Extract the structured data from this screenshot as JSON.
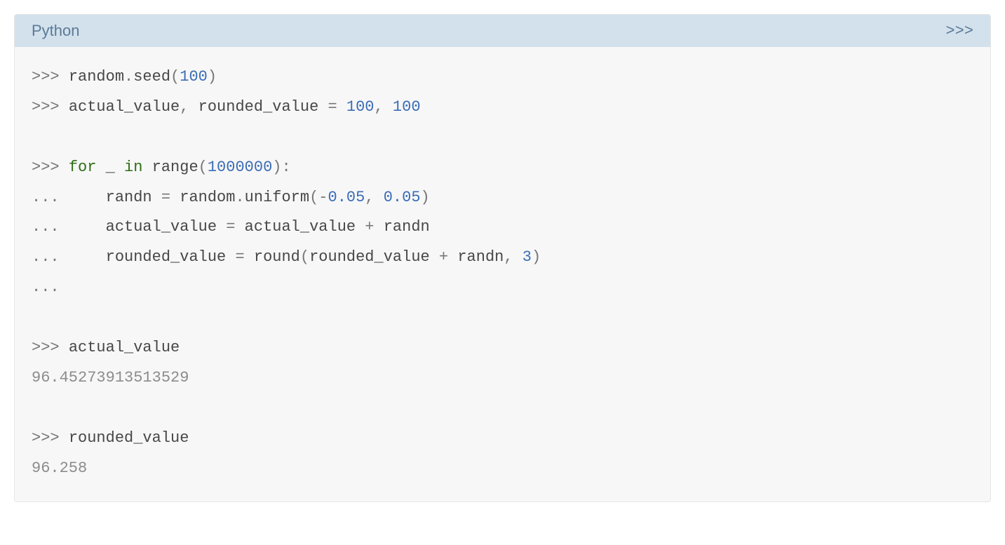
{
  "header": {
    "language": "Python",
    "toggle": ">>>"
  },
  "code": {
    "p1": ">>> ",
    "p2": "... ",
    "l1_ident": "random",
    "l1_dot": ".",
    "l1_func": "seed",
    "l1_lp": "(",
    "l1_n1": "100",
    "l1_rp": ")",
    "l2_a": "actual_value",
    "l2_comma": ", ",
    "l2_b": "rounded_value",
    "l2_eq": " = ",
    "l2_n1": "100",
    "l2_comma2": ", ",
    "l2_n2": "100",
    "l4_for": "for",
    "l4_sp1": " ",
    "l4_us": "_",
    "l4_sp2": " ",
    "l4_in": "in",
    "l4_sp3": " ",
    "l4_range": "range",
    "l4_lp": "(",
    "l4_n": "1000000",
    "l4_rp": "):",
    "l5_indent": "    ",
    "l5_var": "randn",
    "l5_eq": " = ",
    "l5_rand": "random",
    "l5_dot": ".",
    "l5_unif": "uniform",
    "l5_lp": "(",
    "l5_neg": "-",
    "l5_n1": "0.05",
    "l5_comma": ", ",
    "l5_n2": "0.05",
    "l5_rp": ")",
    "l6_var": "actual_value",
    "l6_eq": " = ",
    "l6_var2": "actual_value",
    "l6_plus": " + ",
    "l6_randn": "randn",
    "l7_var": "rounded_value",
    "l7_eq": " = ",
    "l7_round": "round",
    "l7_lp": "(",
    "l7_var2": "rounded_value",
    "l7_plus": " + ",
    "l7_randn": "randn",
    "l7_comma": ", ",
    "l7_n": "3",
    "l7_rp": ")",
    "l10_var": "actual_value",
    "l11_out": "96.45273913513529",
    "l13_var": "rounded_value",
    "l14_out": "96.258"
  }
}
